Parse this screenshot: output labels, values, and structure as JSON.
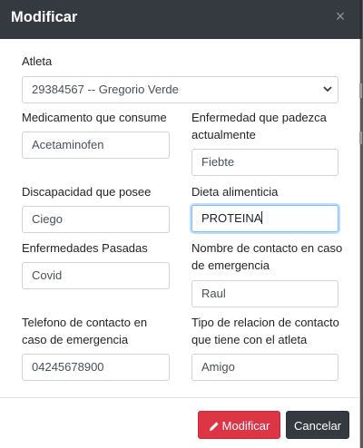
{
  "modal": {
    "title": "Modificar",
    "close_symbol": "×"
  },
  "form": {
    "athlete": {
      "label": "Atleta",
      "selected": "29384567 -- Gregorio Verde"
    },
    "medication": {
      "label": "Medicamento que consume",
      "value": "Acetaminofen"
    },
    "current_illness": {
      "label": "Enfermedad que padezca actualmente",
      "value": "Fiebte"
    },
    "disability": {
      "label": "Discapacidad que posee",
      "value": "Ciego"
    },
    "diet": {
      "label": "Dieta alimenticia",
      "value": "PROTEINA"
    },
    "past_illnesses": {
      "label": "Enfermedades Pasadas",
      "value": "Covid"
    },
    "emergency_contact_name": {
      "label": "Nombre de contacto en caso de emergencia",
      "value": "Raul"
    },
    "emergency_contact_phone": {
      "label": "Telefono de contacto en caso de emergencia",
      "value": "04245678900"
    },
    "contact_relationship": {
      "label": "Tipo de relacion de contacto que tiene con el atleta",
      "value": "Amigo"
    }
  },
  "footer": {
    "modify_label": "Modificar",
    "cancel_label": "Cancelar"
  },
  "icons": {
    "modify": "pencil-icon",
    "close": "close-icon",
    "select": "chevron-down-icon"
  },
  "colors": {
    "header_bg": "#343a40",
    "modify_button": "#dc3545",
    "cancel_button": "#343a40",
    "focus_border": "#80bdff"
  }
}
